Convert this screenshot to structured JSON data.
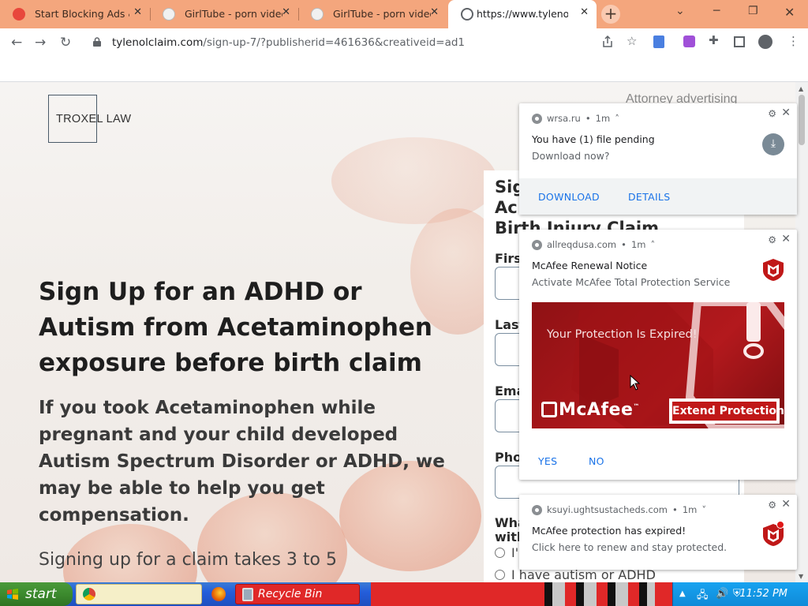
{
  "browser": {
    "tabs": [
      {
        "label": "Start Blocking Ads &",
        "active": false
      },
      {
        "label": "GirlTube - porn video",
        "active": false
      },
      {
        "label": "GirlTube - porn video",
        "active": false
      },
      {
        "label": "https://www.tylenolcl",
        "active": true
      }
    ],
    "new_tab": "+",
    "url_host": "tylenolclaim.com",
    "url_path": "/sign-up-7/?publisherid=461636&creativeid=ad1"
  },
  "page": {
    "logo": "TROXEL LAW",
    "attorney_note": "Attorney advertising",
    "headline": "Sign Up for an ADHD or Autism from Acetaminophen exposure before birth claim",
    "subheadline": "If you took Acetaminophen while pregnant and your child developed Autism Spectrum Disorder or ADHD, we may be able to help you get compensation.",
    "signing_text": "Signing up for a claim takes 3 to 5",
    "form": {
      "title_line1": "Sig",
      "title_line2": "Ac",
      "title_line3": "Birth Injury Claim",
      "first_label": "First",
      "last_label": "Last",
      "email_label": "Ema",
      "phone_label": "Pho",
      "question_line1": "Wha",
      "question_line2": "with",
      "option1": "I'",
      "option2": "I have autism or ADHD"
    }
  },
  "notifications": [
    {
      "site": "wrsa.ru",
      "time": "1m",
      "title": "You have (1) file pending",
      "message": "Download now?",
      "buttons": [
        "DOWNLOAD",
        "DETAILS"
      ]
    },
    {
      "site": "allreqdusa.com",
      "time": "1m",
      "title": "McAfee Renewal Notice",
      "message": "Activate McAfee Total Protection Service",
      "banner_headline": "Your Protection Is Expired!",
      "banner_brand": "McAfee",
      "banner_button": "Extend Protection",
      "buttons": [
        "YES",
        "NO"
      ]
    },
    {
      "site": "ksuyi.ughtsustacheds.com",
      "time": "1m",
      "title": "McAfee protection has expired!",
      "message": "Click here to renew and stay protected."
    }
  ],
  "taskbar": {
    "start_label": "start",
    "recycle_bin": "Recycle Bin",
    "clock": "11:52 PM"
  },
  "colors": {
    "tab_strip": "#f4a67d",
    "mcafee_red": "#c01818",
    "link_blue": "#1a73e8",
    "xp_blue": "#245edb",
    "xp_green": "#3c8a2e"
  }
}
